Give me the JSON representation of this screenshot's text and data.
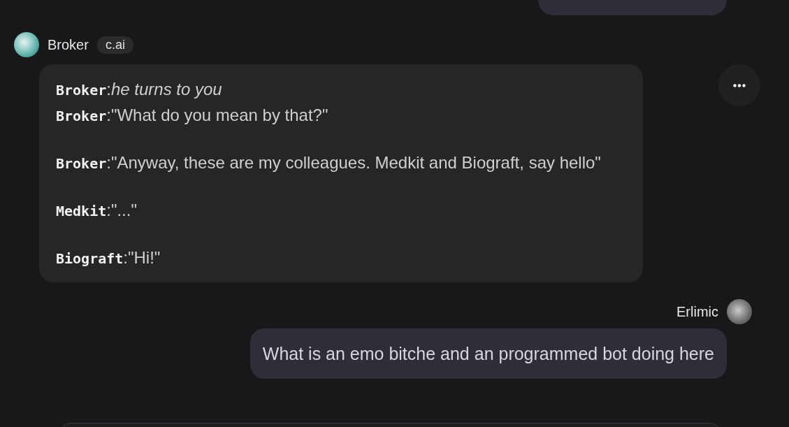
{
  "bot": {
    "name": "Broker",
    "badge": "c.ai"
  },
  "bot_message": {
    "paragraphs": [
      [
        {
          "speaker": "Broker",
          "separator": ":",
          "kind": "action",
          "text": "he turns to you"
        },
        {
          "speaker": "Broker",
          "separator": ":",
          "kind": "speech",
          "text": "\"What do you mean by that?\""
        }
      ],
      [
        {
          "speaker": "Broker",
          "separator": ":",
          "kind": "speech",
          "text": "\"Anyway, these are my colleagues. Medkit and Biograft, say hello\""
        }
      ],
      [
        {
          "speaker": "Medkit",
          "separator": ":",
          "kind": "speech",
          "text": "\"...\""
        }
      ],
      [
        {
          "speaker": "Biograft",
          "separator": ":",
          "kind": "speech",
          "text": "\"Hi!\""
        }
      ]
    ]
  },
  "user": {
    "name": "Erlimic"
  },
  "user_message": {
    "text": "What is an emo bitche and an programmed bot doing here"
  }
}
